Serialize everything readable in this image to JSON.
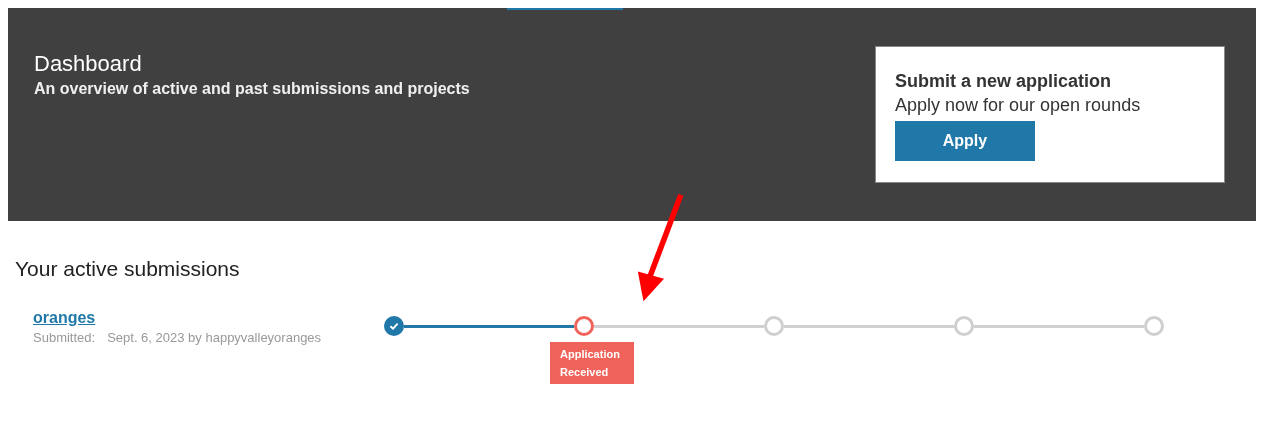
{
  "header": {
    "title": "Dashboard",
    "subtitle": "An overview of active and past submissions and projects"
  },
  "apply_card": {
    "title": "Submit a new application",
    "text": "Apply now for our open rounds",
    "button": "Apply"
  },
  "section_title": "Your active submissions",
  "submissions": [
    {
      "name": "oranges",
      "submitted_label": "Submitted:",
      "submitted_value": "Sept. 6, 2023 by happyvalleyoranges",
      "steps": [
        {
          "kind": "done"
        },
        {
          "kind": "current",
          "label": "Application Received"
        },
        {
          "kind": "pending"
        },
        {
          "kind": "pending"
        },
        {
          "kind": "pending"
        }
      ]
    }
  ],
  "annotation": {
    "kind": "arrow",
    "color": "#ff0000"
  }
}
